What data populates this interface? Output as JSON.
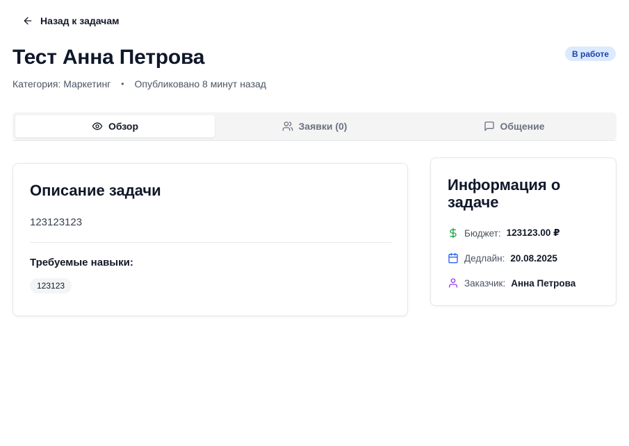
{
  "back": {
    "label": "Назад к задачам",
    "icon": "arrow-left-icon"
  },
  "task": {
    "title": "Тест Анна Петрова",
    "status": "В работе",
    "category_label": "Категория: Маркетинг",
    "separator": "•",
    "published": "Опубликовано 8 минут назад"
  },
  "tabs": [
    {
      "label": "Обзор",
      "icon": "eye-icon",
      "active": true
    },
    {
      "label": "Заявки (0)",
      "icon": "users-icon",
      "active": false
    },
    {
      "label": "Общение",
      "icon": "message-square-icon",
      "active": false
    }
  ],
  "description": {
    "heading": "Описание задачи",
    "text": "123123123",
    "skills_heading": "Требуемые навыки:",
    "skills": [
      "123123"
    ]
  },
  "info": {
    "heading": "Информация о задаче",
    "budget_label": "Бюджет:",
    "budget_value": "123123.00 ₽",
    "deadline_label": "Дедлайн:",
    "deadline_value": "20.08.2025",
    "customer_label": "Заказчик:",
    "customer_value": "Анна Петрова"
  },
  "colors": {
    "status_bg": "#dbeafe",
    "status_text": "#1e40af",
    "budget_icon": "#16a34a",
    "deadline_icon": "#2563eb",
    "customer_icon": "#9333ea"
  }
}
